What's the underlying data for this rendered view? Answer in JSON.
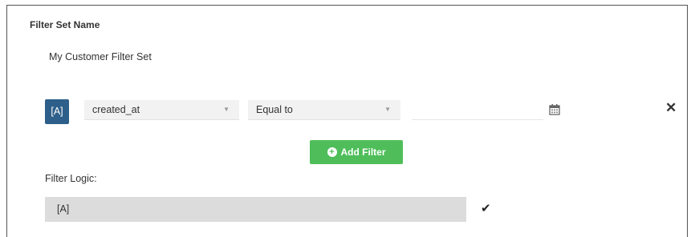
{
  "filter_set": {
    "name_label": "Filter Set Name",
    "name_value": "My Customer Filter Set"
  },
  "filter_row": {
    "badge": "[A]",
    "field_value": "created_at",
    "operator_value": "Equal to",
    "date_value": "",
    "icons": {
      "calendar": "calendar-icon",
      "remove": "close-icon",
      "caret": "chevron-down-icon"
    }
  },
  "add_filter": {
    "label": "Add Filter",
    "icon": "plus-circle-icon",
    "color": "#4fbe5a"
  },
  "filter_logic": {
    "label": "Filter Logic:",
    "value": "[A]",
    "confirm_icon": "check-icon"
  },
  "colors": {
    "badge_bg": "#2d5f8a",
    "select_bg": "#f2f2f2",
    "logic_bg": "#dcdcdc"
  }
}
